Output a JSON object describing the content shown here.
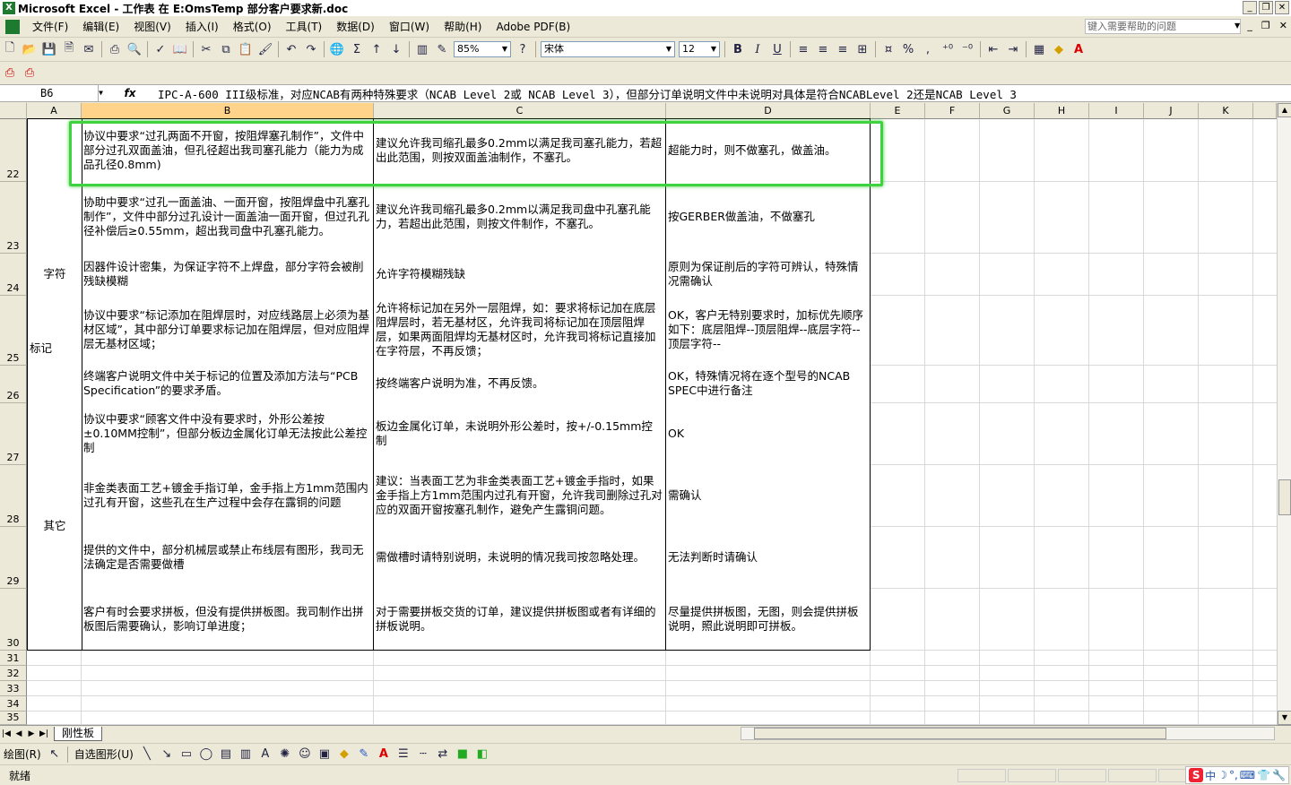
{
  "window": {
    "title": "Microsoft Excel - 工作表 在 E:OmsTemp 部分客户要求新.doc",
    "controls": [
      "_",
      "❐",
      "✕"
    ]
  },
  "menubar": {
    "items": [
      "文件(F)",
      "编辑(E)",
      "视图(V)",
      "插入(I)",
      "格式(O)",
      "工具(T)",
      "数据(D)",
      "窗口(W)",
      "帮助(H)",
      "Adobe PDF(B)"
    ],
    "help_placeholder": "键入需要帮助的问题"
  },
  "toolbar": {
    "zoom": "85%",
    "font_name": "宋体",
    "font_size": "12",
    "bold": "B",
    "italic": "I",
    "underline": "U",
    "percent": "%",
    "comma": ","
  },
  "formula_bar": {
    "name_box": "B6",
    "fx": "fx",
    "content": "IPC-A-600 III级标准，对应NCAB有两种特殊要求（NCAB Level 2或 NCAB Level 3），但部分订单说明文件中未说明对具体是符合NCABLevel 2还是NCAB Level 3"
  },
  "columns": [
    "A",
    "B",
    "C",
    "D",
    "E",
    "F",
    "G",
    "H",
    "I",
    "J",
    "K"
  ],
  "selected_column": "B",
  "row_numbers": [
    "22",
    "23",
    "24",
    "25",
    "26",
    "27",
    "28",
    "29",
    "30",
    "31",
    "32",
    "33",
    "34",
    "35"
  ],
  "groups": [
    {
      "label": "",
      "rows": "22-23"
    },
    {
      "label": "字符",
      "rows": "24"
    },
    {
      "label": "标记",
      "rows": "25-26"
    },
    {
      "label": "其它",
      "rows": "27-30"
    }
  ],
  "rows": [
    {
      "num": "22",
      "b": "协议中要求“过孔两面不开窗，按阻焊塞孔制作”，文件中部分过孔双面盖油，但孔径超出我司塞孔能力（能力为成品孔径0.8mm)",
      "c": "建议允许我司缩孔最多0.2mm以满足我司塞孔能力，若超出此范围，则按双面盖油制作，不塞孔。",
      "d": "超能力时，则不做塞孔，做盖油。"
    },
    {
      "num": "23",
      "b": "协助中要求“过孔一面盖油、一面开窗，按阻焊盘中孔塞孔制作”，文件中部分过孔设计一面盖油一面开窗，但过孔孔径补偿后≥0.55mm，超出我司盘中孔塞孔能力。",
      "c": "建议允许我司缩孔最多0.2mm以满足我司盘中孔塞孔能力，若超出此范围，则按文件制作，不塞孔。",
      "d": "按GERBER做盖油，不做塞孔"
    },
    {
      "num": "24",
      "b": "因器件设计密集，为保证字符不上焊盘，部分字符会被削残缺模糊",
      "c": "允许字符模糊残缺",
      "d": "原则为保证削后的字符可辨认，特殊情况需确认"
    },
    {
      "num": "25",
      "b": "协议中要求“标记添加在阻焊层时，对应线路层上必须为基材区域”，其中部分订单要求标记加在阻焊层，但对应阻焊层无基材区域；",
      "c": "允许将标记加在另外一层阻焊，如：要求将标记加在底层阻焊层时，若无基材区，允许我司将标记加在顶层阻焊层，如果两面阻焊均无基材区时，允许我司将标记直接加在字符层，不再反馈；",
      "d": "OK，客户无特别要求时，加标优先顺序如下：底层阻焊--顶层阻焊--底层字符--顶层字符--"
    },
    {
      "num": "26",
      "b": "终端客户说明文件中关于标记的位置及添加方法与“PCB Specification”的要求矛盾。",
      "c": "按终端客户说明为准，不再反馈。",
      "d": "OK，特殊情况将在逐个型号的NCAB SPEC中进行备注"
    },
    {
      "num": "27",
      "b": "协议中要求“顾客文件中没有要求时，外形公差按±0.10MM控制”，但部分板边金属化订单无法按此公差控制",
      "c": "板边金属化订单，未说明外形公差时，按+/-0.15mm控制",
      "d": "OK"
    },
    {
      "num": "28",
      "b": "非金类表面工艺+镀金手指订单，金手指上方1mm范围内过孔有开窗，这些孔在生产过程中会存在露铜的问题",
      "c": "建议：当表面工艺为非金类表面工艺+镀金手指时，如果金手指上方1mm范围内过孔有开窗，允许我司删除过孔对应的双面开窗按塞孔制作，避免产生露铜问题。",
      "d": "需确认"
    },
    {
      "num": "29",
      "b": "提供的文件中，部分机械层或禁止布线层有图形，我司无法确定是否需要做槽",
      "c": "需做槽时请特别说明，未说明的情况我司按忽略处理。",
      "d": "无法判断时请确认"
    },
    {
      "num": "30",
      "b": "客户有时会要求拼板，但没有提供拼板图。我司制作出拼板图后需要确认，影响订单进度；",
      "c": "对于需要拼板交货的订单，建议提供拼板图或者有详细的拼板说明。",
      "d": "尽量提供拼板图，无图，则会提供拼板说明，照此说明即可拼板。"
    }
  ],
  "sheet_tab": "刚性板",
  "drawing_bar": {
    "draw_label": "绘图(R)",
    "autoshape_label": "自选图形(U)"
  },
  "status": {
    "ready": "就绪",
    "ime": [
      "S",
      "中",
      "☽",
      "°,",
      "⌨",
      "👕",
      "🔧"
    ]
  },
  "highlight_color": "#3fd23f"
}
